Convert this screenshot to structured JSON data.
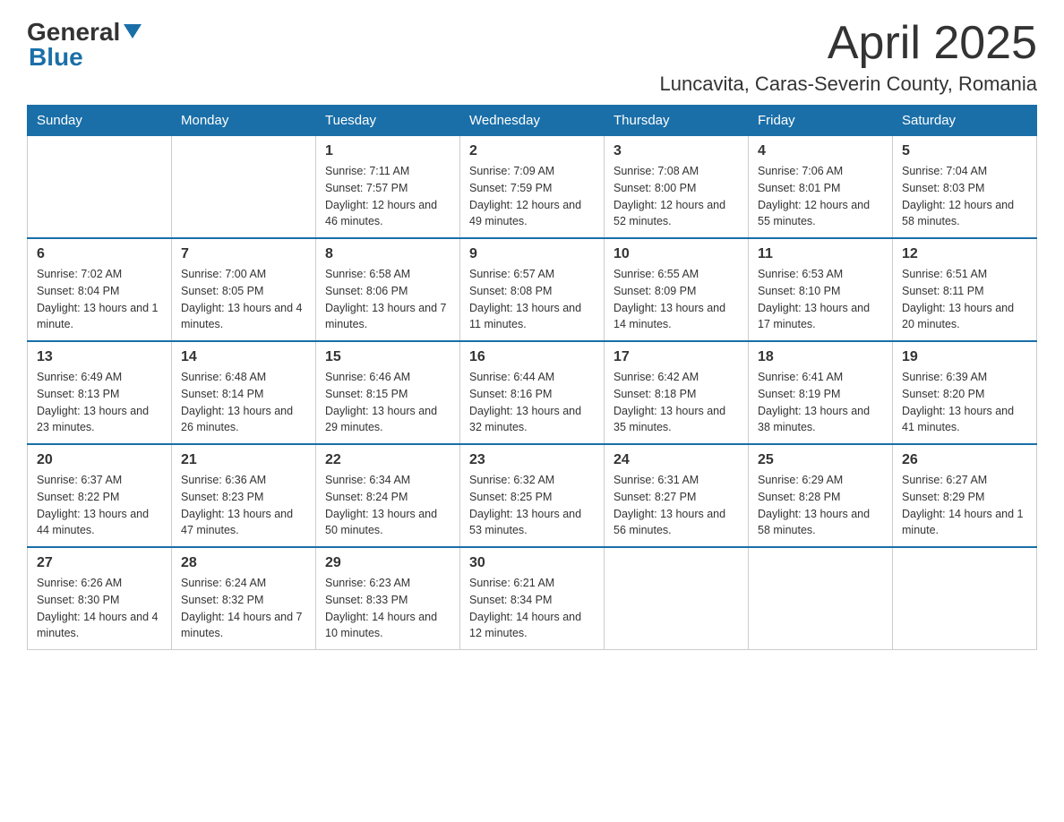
{
  "header": {
    "logo": {
      "general": "General",
      "blue": "Blue"
    },
    "title": "April 2025",
    "location": "Luncavita, Caras-Severin County, Romania"
  },
  "days_of_week": [
    "Sunday",
    "Monday",
    "Tuesday",
    "Wednesday",
    "Thursday",
    "Friday",
    "Saturday"
  ],
  "weeks": [
    [
      {
        "day": "",
        "sunrise": "",
        "sunset": "",
        "daylight": ""
      },
      {
        "day": "",
        "sunrise": "",
        "sunset": "",
        "daylight": ""
      },
      {
        "day": "1",
        "sunrise": "Sunrise: 7:11 AM",
        "sunset": "Sunset: 7:57 PM",
        "daylight": "Daylight: 12 hours and 46 minutes."
      },
      {
        "day": "2",
        "sunrise": "Sunrise: 7:09 AM",
        "sunset": "Sunset: 7:59 PM",
        "daylight": "Daylight: 12 hours and 49 minutes."
      },
      {
        "day": "3",
        "sunrise": "Sunrise: 7:08 AM",
        "sunset": "Sunset: 8:00 PM",
        "daylight": "Daylight: 12 hours and 52 minutes."
      },
      {
        "day": "4",
        "sunrise": "Sunrise: 7:06 AM",
        "sunset": "Sunset: 8:01 PM",
        "daylight": "Daylight: 12 hours and 55 minutes."
      },
      {
        "day": "5",
        "sunrise": "Sunrise: 7:04 AM",
        "sunset": "Sunset: 8:03 PM",
        "daylight": "Daylight: 12 hours and 58 minutes."
      }
    ],
    [
      {
        "day": "6",
        "sunrise": "Sunrise: 7:02 AM",
        "sunset": "Sunset: 8:04 PM",
        "daylight": "Daylight: 13 hours and 1 minute."
      },
      {
        "day": "7",
        "sunrise": "Sunrise: 7:00 AM",
        "sunset": "Sunset: 8:05 PM",
        "daylight": "Daylight: 13 hours and 4 minutes."
      },
      {
        "day": "8",
        "sunrise": "Sunrise: 6:58 AM",
        "sunset": "Sunset: 8:06 PM",
        "daylight": "Daylight: 13 hours and 7 minutes."
      },
      {
        "day": "9",
        "sunrise": "Sunrise: 6:57 AM",
        "sunset": "Sunset: 8:08 PM",
        "daylight": "Daylight: 13 hours and 11 minutes."
      },
      {
        "day": "10",
        "sunrise": "Sunrise: 6:55 AM",
        "sunset": "Sunset: 8:09 PM",
        "daylight": "Daylight: 13 hours and 14 minutes."
      },
      {
        "day": "11",
        "sunrise": "Sunrise: 6:53 AM",
        "sunset": "Sunset: 8:10 PM",
        "daylight": "Daylight: 13 hours and 17 minutes."
      },
      {
        "day": "12",
        "sunrise": "Sunrise: 6:51 AM",
        "sunset": "Sunset: 8:11 PM",
        "daylight": "Daylight: 13 hours and 20 minutes."
      }
    ],
    [
      {
        "day": "13",
        "sunrise": "Sunrise: 6:49 AM",
        "sunset": "Sunset: 8:13 PM",
        "daylight": "Daylight: 13 hours and 23 minutes."
      },
      {
        "day": "14",
        "sunrise": "Sunrise: 6:48 AM",
        "sunset": "Sunset: 8:14 PM",
        "daylight": "Daylight: 13 hours and 26 minutes."
      },
      {
        "day": "15",
        "sunrise": "Sunrise: 6:46 AM",
        "sunset": "Sunset: 8:15 PM",
        "daylight": "Daylight: 13 hours and 29 minutes."
      },
      {
        "day": "16",
        "sunrise": "Sunrise: 6:44 AM",
        "sunset": "Sunset: 8:16 PM",
        "daylight": "Daylight: 13 hours and 32 minutes."
      },
      {
        "day": "17",
        "sunrise": "Sunrise: 6:42 AM",
        "sunset": "Sunset: 8:18 PM",
        "daylight": "Daylight: 13 hours and 35 minutes."
      },
      {
        "day": "18",
        "sunrise": "Sunrise: 6:41 AM",
        "sunset": "Sunset: 8:19 PM",
        "daylight": "Daylight: 13 hours and 38 minutes."
      },
      {
        "day": "19",
        "sunrise": "Sunrise: 6:39 AM",
        "sunset": "Sunset: 8:20 PM",
        "daylight": "Daylight: 13 hours and 41 minutes."
      }
    ],
    [
      {
        "day": "20",
        "sunrise": "Sunrise: 6:37 AM",
        "sunset": "Sunset: 8:22 PM",
        "daylight": "Daylight: 13 hours and 44 minutes."
      },
      {
        "day": "21",
        "sunrise": "Sunrise: 6:36 AM",
        "sunset": "Sunset: 8:23 PM",
        "daylight": "Daylight: 13 hours and 47 minutes."
      },
      {
        "day": "22",
        "sunrise": "Sunrise: 6:34 AM",
        "sunset": "Sunset: 8:24 PM",
        "daylight": "Daylight: 13 hours and 50 minutes."
      },
      {
        "day": "23",
        "sunrise": "Sunrise: 6:32 AM",
        "sunset": "Sunset: 8:25 PM",
        "daylight": "Daylight: 13 hours and 53 minutes."
      },
      {
        "day": "24",
        "sunrise": "Sunrise: 6:31 AM",
        "sunset": "Sunset: 8:27 PM",
        "daylight": "Daylight: 13 hours and 56 minutes."
      },
      {
        "day": "25",
        "sunrise": "Sunrise: 6:29 AM",
        "sunset": "Sunset: 8:28 PM",
        "daylight": "Daylight: 13 hours and 58 minutes."
      },
      {
        "day": "26",
        "sunrise": "Sunrise: 6:27 AM",
        "sunset": "Sunset: 8:29 PM",
        "daylight": "Daylight: 14 hours and 1 minute."
      }
    ],
    [
      {
        "day": "27",
        "sunrise": "Sunrise: 6:26 AM",
        "sunset": "Sunset: 8:30 PM",
        "daylight": "Daylight: 14 hours and 4 minutes."
      },
      {
        "day": "28",
        "sunrise": "Sunrise: 6:24 AM",
        "sunset": "Sunset: 8:32 PM",
        "daylight": "Daylight: 14 hours and 7 minutes."
      },
      {
        "day": "29",
        "sunrise": "Sunrise: 6:23 AM",
        "sunset": "Sunset: 8:33 PM",
        "daylight": "Daylight: 14 hours and 10 minutes."
      },
      {
        "day": "30",
        "sunrise": "Sunrise: 6:21 AM",
        "sunset": "Sunset: 8:34 PM",
        "daylight": "Daylight: 14 hours and 12 minutes."
      },
      {
        "day": "",
        "sunrise": "",
        "sunset": "",
        "daylight": ""
      },
      {
        "day": "",
        "sunrise": "",
        "sunset": "",
        "daylight": ""
      },
      {
        "day": "",
        "sunrise": "",
        "sunset": "",
        "daylight": ""
      }
    ]
  ]
}
